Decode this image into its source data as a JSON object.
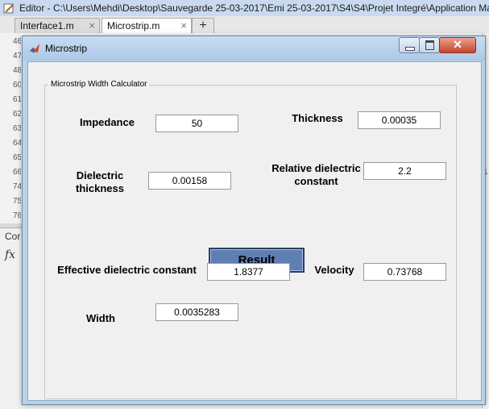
{
  "editor": {
    "title": "Editor - C:\\Users\\Mehdi\\Desktop\\Sauvegarde 25-03-2017\\Emi 25-03-2017\\S4\\S4\\Projet Integré\\Application Ma",
    "tabs": [
      {
        "label": "Interface1.m",
        "close": "×"
      },
      {
        "label": "Microstrip.m",
        "close": "×"
      }
    ],
    "add_tab": "+",
    "line_numbers": [
      "46",
      "47",
      "48",
      "60",
      "61",
      "62",
      "63",
      "64",
      "65",
      "66",
      "74",
      "75",
      "76"
    ],
    "command_window_label": "Cor",
    "fx": "fx",
    "side_digit": "1"
  },
  "figure": {
    "title": "Microstrip",
    "close_glyph": "✕",
    "panel_title": "Microstrip Width Calculator",
    "labels": {
      "impedance": "Impedance",
      "thickness": "Thickness",
      "dielectric_thickness": "Dielectric thickness",
      "relative_dielectric_constant": "Relative dielectric constant",
      "effective_dielectric_constant": "Effective dielectric constant",
      "velocity": "Velocity",
      "width": "Width"
    },
    "values": {
      "impedance": "50",
      "thickness": "0.00035",
      "dielectric_thickness": "0.00158",
      "relative_dielectric_constant": "2.2",
      "effective_dielectric_constant": "1.8377",
      "velocity": "0.73768",
      "width": "0.0035283"
    },
    "result_button": "Result"
  },
  "colors": {
    "title_bar": "#b9d1ea",
    "result_button": "#5f7fb3",
    "close_button": "#c8432b"
  }
}
